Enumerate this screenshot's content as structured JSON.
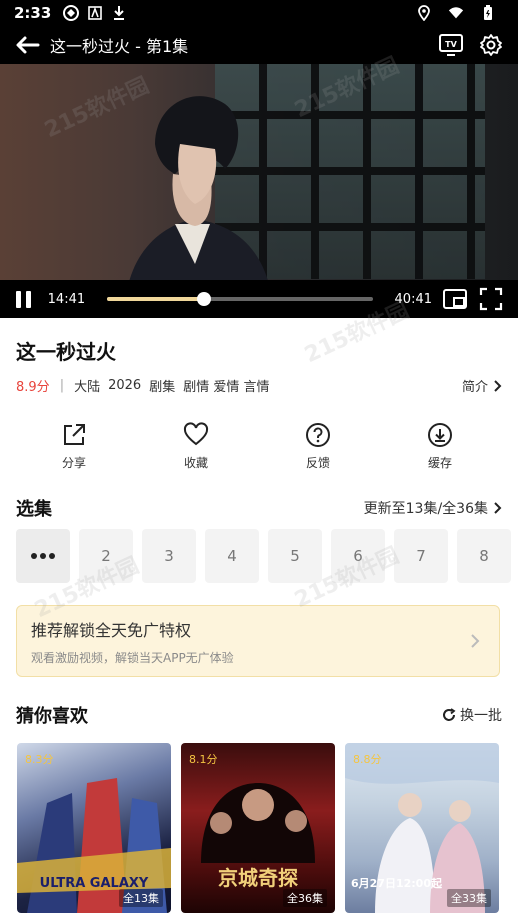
{
  "status": {
    "time": "2:33"
  },
  "player": {
    "title": "这一秒过火 - 第1集",
    "current_time": "14:41",
    "total_time": "40:41",
    "progress": 0.36
  },
  "show": {
    "title": "这一秒过火",
    "score": "8.9分",
    "region": "大陆",
    "year": "2026",
    "tags": [
      "剧集",
      "剧情 爱情 言情"
    ],
    "intro_label": "简介"
  },
  "actions": [
    {
      "label": "分享",
      "icon": "share-icon"
    },
    {
      "label": "收藏",
      "icon": "heart-icon"
    },
    {
      "label": "反馈",
      "icon": "question-icon"
    },
    {
      "label": "缓存",
      "icon": "download-icon"
    }
  ],
  "episodes": {
    "heading": "选集",
    "update_text": "更新至13集/全36集",
    "items": [
      "2",
      "3",
      "4",
      "5",
      "6",
      "7",
      "8"
    ]
  },
  "banner": {
    "title": "推荐解锁全天免广特权",
    "subtitle": "观看激励视频，解锁当天APP无广体验"
  },
  "recommend": {
    "heading": "猜你喜欢",
    "refresh_label": "换一批",
    "cards": [
      {
        "score": "8.3分",
        "episodes": "全13集",
        "caption": "ULTRA GALAXY"
      },
      {
        "score": "8.1分",
        "episodes": "全36集",
        "caption": "京城奇探"
      },
      {
        "score": "8.8分",
        "episodes": "全33集",
        "caption": "6月27日12:00起"
      }
    ]
  },
  "watermark": "215软件园",
  "colors": {
    "accent_red": "#e8443c",
    "progress": "#f0d79b",
    "banner_bg": "#fdf4dc"
  }
}
